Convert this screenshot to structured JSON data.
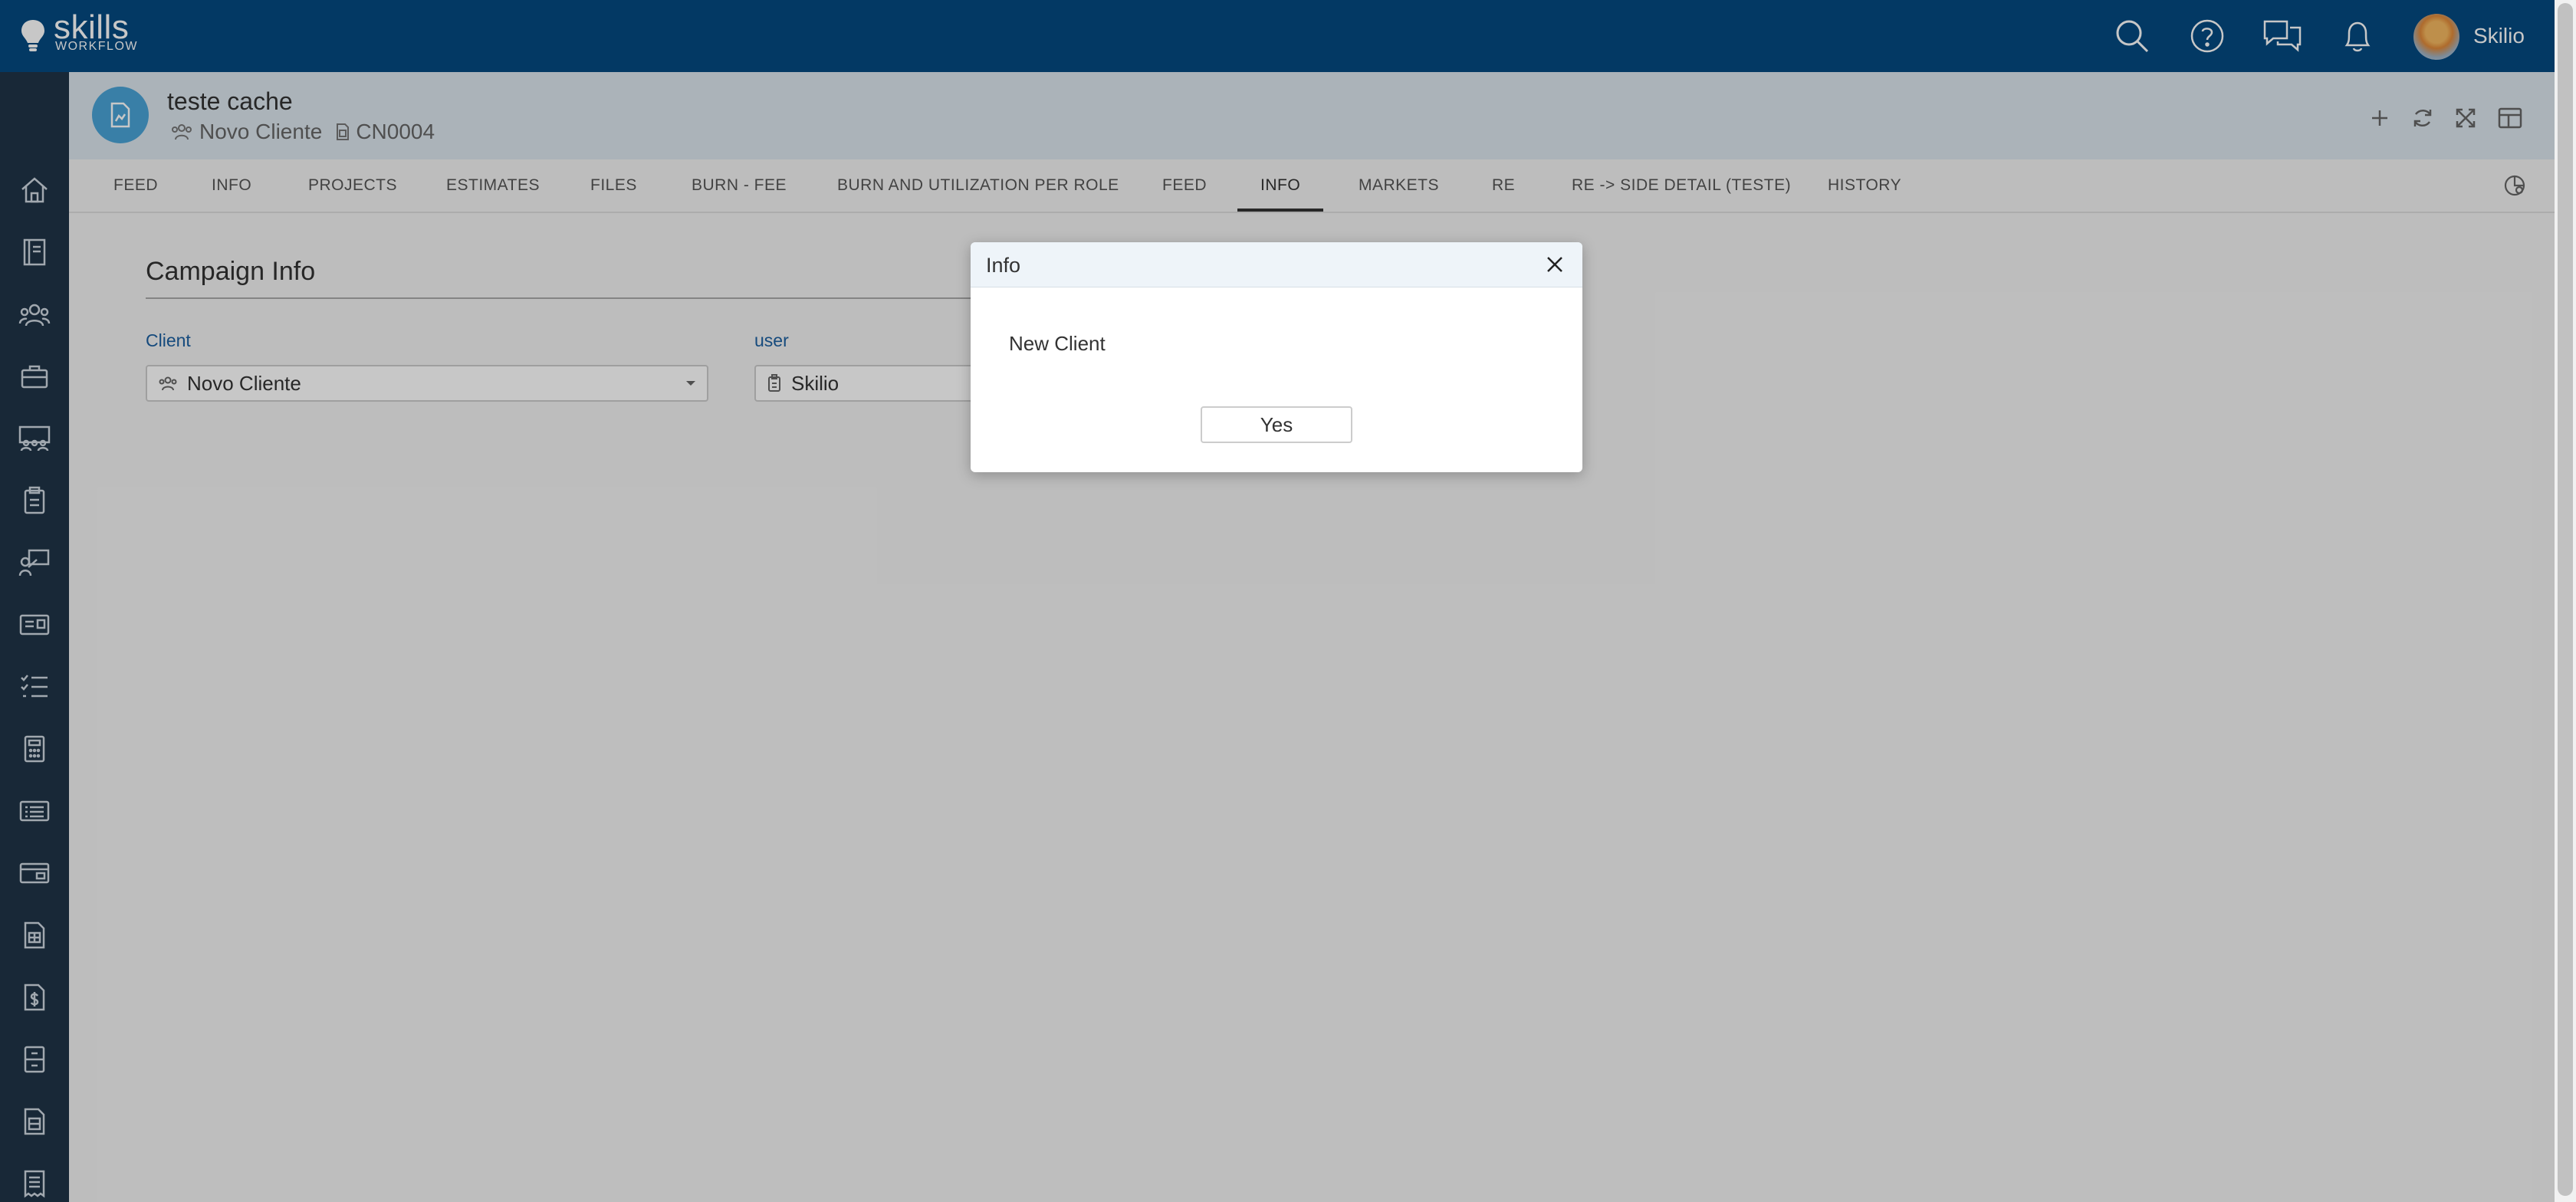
{
  "app": {
    "logo_text": "skills",
    "logo_subtext": "WORKFLOW",
    "user_name": "Skilio"
  },
  "header": {
    "title": "teste cache",
    "client": "Novo Cliente",
    "code": "CN0004"
  },
  "tabs": [
    "FEED",
    "INFO",
    "PROJECTS",
    "ESTIMATES",
    "FILES",
    "BURN - FEE",
    "BURN AND UTILIZATION PER ROLE",
    "FEED",
    "INFO",
    "MARKETS",
    "RE",
    "RE -> SIDE DETAIL (TESTE)",
    "HISTORY"
  ],
  "active_tab_index": 8,
  "section": {
    "title": "Campaign Info",
    "client_label": "Client",
    "client_value": "Novo Cliente",
    "user_label": "user",
    "user_value": "Skilio"
  },
  "dialog": {
    "title": "Info",
    "message": "New Client",
    "confirm_label": "Yes"
  },
  "colors": {
    "topbar": "#054a81",
    "sidebar": "#1f3447",
    "accent": "#4aa3d6",
    "label_blue": "#1b5fa0"
  },
  "icons": {
    "topbar": [
      "search-icon",
      "help-icon",
      "chat-icon",
      "bell-icon"
    ],
    "sidebar": [
      "home-icon",
      "book-icon",
      "users-icon",
      "briefcase-icon",
      "team-icon",
      "clipboard-icon",
      "presenter-icon",
      "id-card-icon",
      "checklist-icon",
      "calculator-icon",
      "list-card-icon",
      "wallet-icon",
      "invoice-icon",
      "money-doc-icon",
      "archive-icon",
      "document-icon",
      "receipt-icon"
    ],
    "header_tools": [
      "add-icon",
      "refresh-icon",
      "expand-icon",
      "layout-icon"
    ]
  }
}
